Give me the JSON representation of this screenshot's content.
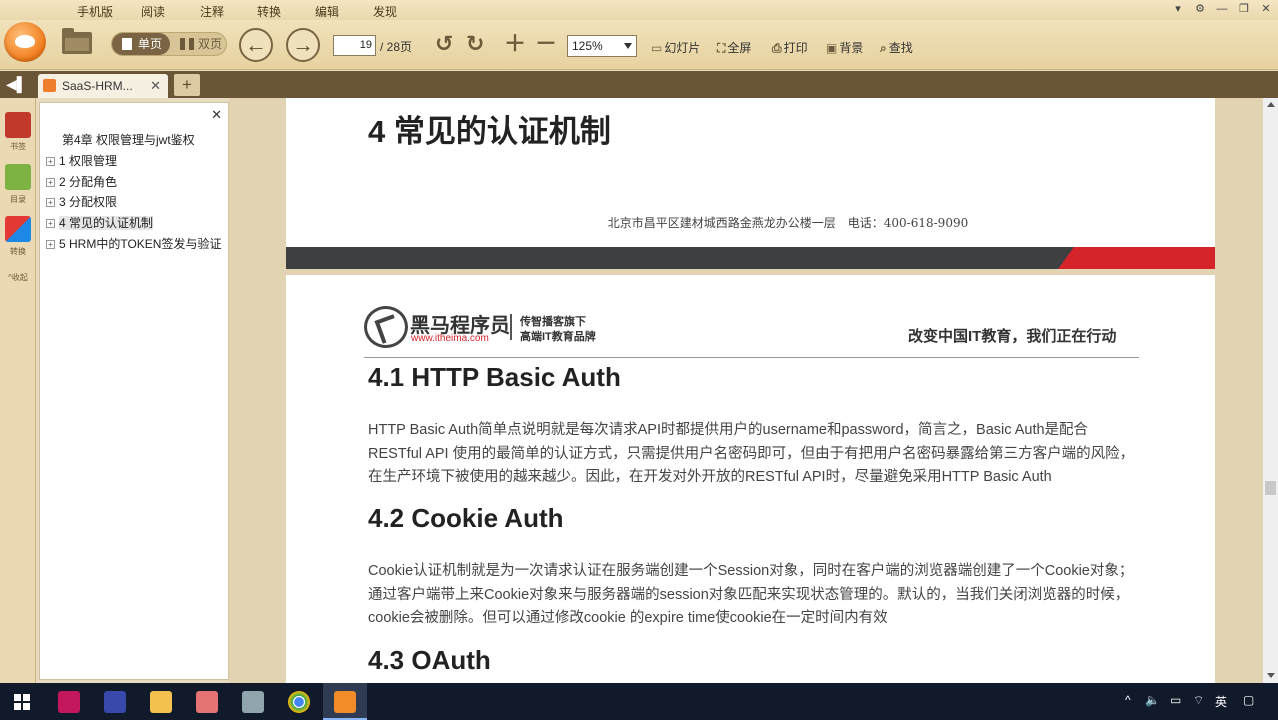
{
  "menu": {
    "items": [
      "手机版",
      "阅读",
      "注释",
      "转换",
      "编辑",
      "发现"
    ]
  },
  "window_controls": {
    "settings": "⚙",
    "minimize": "—",
    "maximize": "❐",
    "close": "✕"
  },
  "toolbar": {
    "single_page": "单页",
    "double_page": "双页",
    "current_page": "19",
    "total_pages": "/ 28页",
    "zoom": "125%",
    "slideshow": "幻灯片",
    "fullscreen": "全屏",
    "print": "打印",
    "background": "背景",
    "find": "查找"
  },
  "tabs": {
    "active_label": "SaaS-HRM...",
    "add": "+"
  },
  "side_icons": {
    "bookmarks": "书签",
    "outline": "目录",
    "convert": "转换",
    "collapse": "^收起"
  },
  "outline": {
    "items": [
      {
        "label": "第4章 权限管理与jwt鉴权",
        "expand": ""
      },
      {
        "label": "1 权限管理",
        "expand": "+"
      },
      {
        "label": "2 分配角色",
        "expand": "+"
      },
      {
        "label": "3 分配权限",
        "expand": "+"
      },
      {
        "label": "4 常见的认证机制",
        "expand": "+"
      },
      {
        "label": "5 HRM中的TOKEN签发与验证",
        "expand": "+"
      }
    ]
  },
  "document": {
    "top_heading": "4 常见的认证机制",
    "footer_address": "北京市昌平区建材城西路金燕龙办公楼一层　电话：400-618-9090",
    "brand": {
      "name": "黑马程序员",
      "url": "www.itheima.com",
      "tagline1": "传智播客旗下",
      "tagline2": "高端IT教育品牌",
      "slogan": "改变中国IT教育，我们正在行动"
    },
    "sections": [
      {
        "heading": "4.1 HTTP Basic Auth",
        "body": "HTTP Basic Auth简单点说明就是每次请求API时都提供用户的username和password，简言之，Basic Auth是配合RESTful API 使用的最简单的认证方式，只需提供用户名密码即可，但由于有把用户名密码暴露给第三方客户端的风险，在生产环境下被使用的越来越少。因此，在开发对外开放的RESTful API时，尽量避免采用HTTP Basic Auth"
      },
      {
        "heading": "4.2 Cookie Auth",
        "body": "Cookie认证机制就是为一次请求认证在服务端创建一个Session对象，同时在客户端的浏览器端创建了一个Cookie对象；通过客户端带上来Cookie对象来与服务器端的session对象匹配来实现状态管理的。默认的，当我们关闭浏览器的时候，cookie会被删除。但可以通过修改cookie 的expire time使cookie在一定时间内有效"
      },
      {
        "heading": "4.3 OAuth",
        "body": ""
      }
    ]
  },
  "taskbar": {
    "tray_lang": "英",
    "tray_chevron": "^"
  },
  "colors": {
    "toolbar_bg": "#ead8ac",
    "tabbar_bg": "#6a5636",
    "accent_red": "#d5232a",
    "dark_bar": "#3e3f40",
    "taskbar_bg": "#101a2a"
  }
}
